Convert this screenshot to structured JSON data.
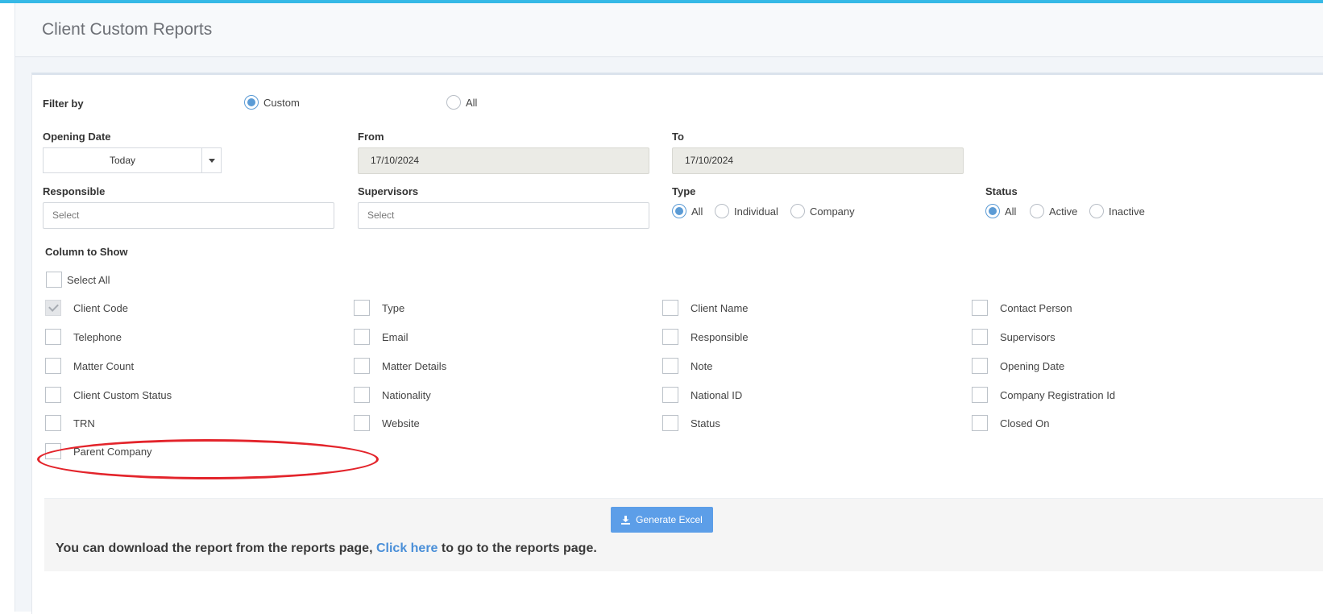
{
  "page": {
    "title": "Client Custom Reports"
  },
  "filter": {
    "label": "Filter by",
    "options": [
      {
        "label": "Custom",
        "selected": true
      },
      {
        "label": "All",
        "selected": false
      }
    ]
  },
  "opening_date": {
    "label": "Opening Date",
    "value": "Today"
  },
  "from": {
    "label": "From",
    "value": "17/10/2024"
  },
  "to": {
    "label": "To",
    "value": "17/10/2024"
  },
  "responsible": {
    "label": "Responsible",
    "placeholder": "Select"
  },
  "supervisors": {
    "label": "Supervisors",
    "placeholder": "Select"
  },
  "type": {
    "label": "Type",
    "options": [
      {
        "label": "All",
        "selected": true
      },
      {
        "label": "Individual",
        "selected": false
      },
      {
        "label": "Company",
        "selected": false
      }
    ]
  },
  "status": {
    "label": "Status",
    "options": [
      {
        "label": "All",
        "selected": true
      },
      {
        "label": "Active",
        "selected": false
      },
      {
        "label": "Inactive",
        "selected": false
      }
    ]
  },
  "columns": {
    "label": "Column to Show",
    "select_all": "Select All",
    "items": [
      {
        "label": "Client Code",
        "checked": true,
        "disabled": true
      },
      {
        "label": "Type"
      },
      {
        "label": "Client Name"
      },
      {
        "label": "Contact Person"
      },
      {
        "label": "Telephone"
      },
      {
        "label": "Email"
      },
      {
        "label": "Responsible"
      },
      {
        "label": "Supervisors"
      },
      {
        "label": "Matter Count"
      },
      {
        "label": "Matter Details"
      },
      {
        "label": "Note"
      },
      {
        "label": "Opening Date"
      },
      {
        "label": "Client Custom Status"
      },
      {
        "label": "Nationality"
      },
      {
        "label": "National ID"
      },
      {
        "label": "Company Registration Id"
      },
      {
        "label": "TRN"
      },
      {
        "label": "Website"
      },
      {
        "label": "Status"
      },
      {
        "label": "Closed On"
      },
      {
        "label": "Parent Company"
      }
    ]
  },
  "footer": {
    "button_label": "Generate Excel",
    "message_before": "You can download the report from the reports page,",
    "link_text": "Click here",
    "message_after": "to go to the reports page."
  },
  "colors": {
    "accent": "#5c9ee8",
    "top_strip": "#36b9e6",
    "highlight": "#e3242b"
  }
}
